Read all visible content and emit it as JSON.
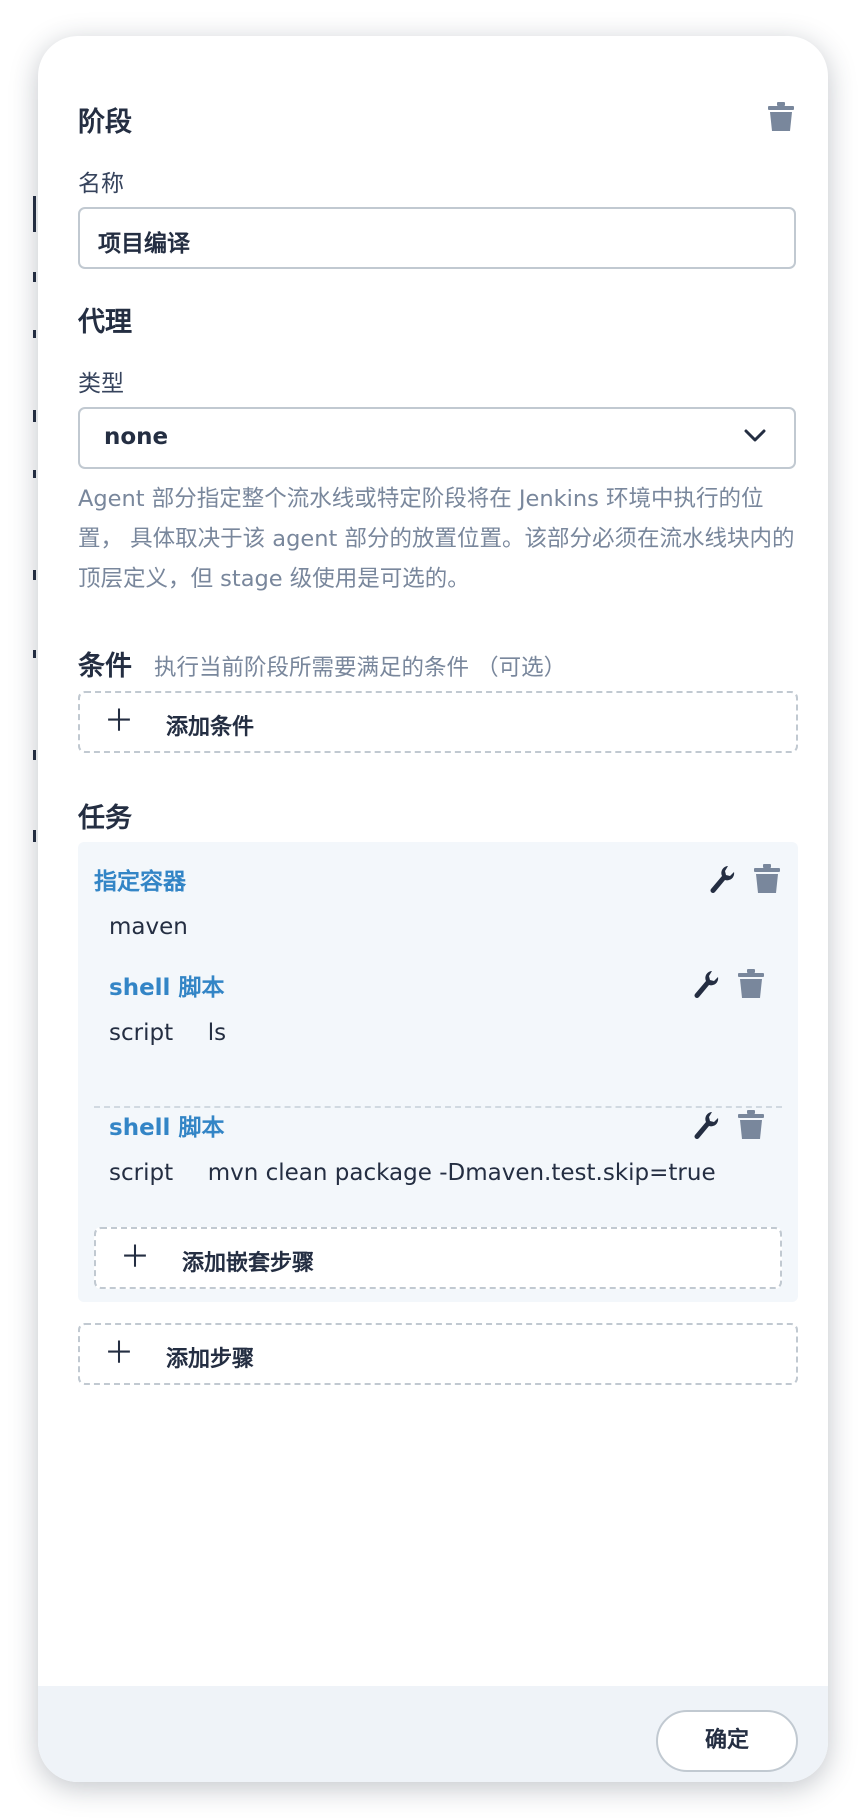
{
  "stage": {
    "title": "阶段",
    "name_label": "名称",
    "name_value": "项目编译"
  },
  "agent": {
    "title": "代理",
    "type_label": "类型",
    "type_value": "none",
    "description": "Agent 部分指定整个流水线或特定阶段将在 Jenkins 环境中执行的位置， 具体取决于该 agent 部分的放置位置。该部分必须在流水线块内的顶层定义，但 stage 级使用是可选的。"
  },
  "conditions": {
    "title": "条件",
    "hint": "执行当前阶段所需要满足的条件 （可选）",
    "add_label": "添加条件"
  },
  "tasks": {
    "title": "任务",
    "container": {
      "title": "指定容器",
      "value": "maven",
      "steps": [
        {
          "title": "shell 脚本",
          "key": "script",
          "value": "ls"
        },
        {
          "title": "shell 脚本",
          "key": "script",
          "value": "mvn clean package -Dmaven.test.skip=true"
        }
      ],
      "add_nested_label": "添加嵌套步骤"
    },
    "add_step_label": "添加步骤"
  },
  "footer": {
    "confirm_label": "确定"
  },
  "icons": {
    "delete": "trash-icon",
    "edit": "wrench-icon",
    "add": "plus-icon",
    "dropdown": "chevron-down-icon"
  },
  "colors": {
    "accent_blue": "#3385c6",
    "icon_gray": "#79879c",
    "text_dark": "#242e42"
  }
}
